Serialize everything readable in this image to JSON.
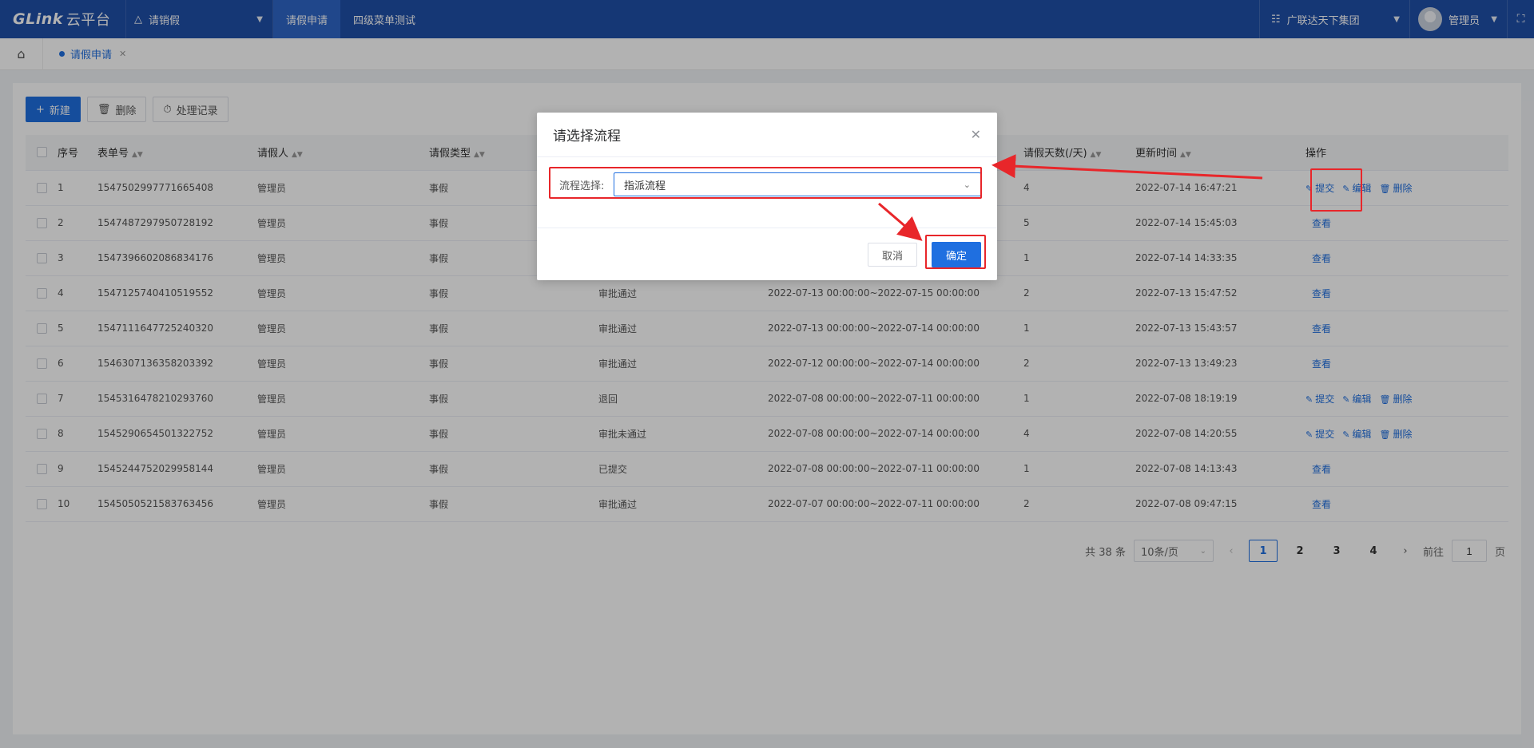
{
  "topbar": {
    "logo": "GLink",
    "logo_sub": "云平台",
    "app_name": "请销假",
    "menu": [
      "请假申请",
      "四级菜单测试"
    ],
    "org_name": "广联达天下集团",
    "user_name": "管理员",
    "accent": "#1f4fa8"
  },
  "tabs": {
    "active": "请假申请"
  },
  "toolbar": {
    "new": "新建",
    "delete": "删除",
    "records": "处理记录"
  },
  "table": {
    "headers": [
      "序号",
      "表单号",
      "请假人",
      "请假类型",
      "",
      "",
      "请假天数(/天)",
      "更新时间",
      "操作"
    ],
    "rows": [
      {
        "no": "1",
        "form": "1547502997771665408",
        "person": "管理员",
        "type": "事假",
        "status": "",
        "range": "",
        "days": "4",
        "updated": "2022-07-14 16:47:21",
        "ops": [
          "提交",
          "编辑",
          "删除"
        ]
      },
      {
        "no": "2",
        "form": "1547487297950728192",
        "person": "管理员",
        "type": "事假",
        "status": "",
        "range": "",
        "days": "5",
        "updated": "2022-07-14 15:45:03",
        "ops": [
          "查看"
        ]
      },
      {
        "no": "3",
        "form": "1547396602086834176",
        "person": "管理员",
        "type": "事假",
        "status": "",
        "range": "",
        "days": "1",
        "updated": "2022-07-14 14:33:35",
        "ops": [
          "查看"
        ]
      },
      {
        "no": "4",
        "form": "1547125740410519552",
        "person": "管理员",
        "type": "事假",
        "status": "审批通过",
        "range": "2022-07-13 00:00:00~2022-07-15 00:00:00",
        "days": "2",
        "updated": "2022-07-13 15:47:52",
        "ops": [
          "查看"
        ]
      },
      {
        "no": "5",
        "form": "1547111647725240320",
        "person": "管理员",
        "type": "事假",
        "status": "审批通过",
        "range": "2022-07-13 00:00:00~2022-07-14 00:00:00",
        "days": "1",
        "updated": "2022-07-13 15:43:57",
        "ops": [
          "查看"
        ]
      },
      {
        "no": "6",
        "form": "1546307136358203392",
        "person": "管理员",
        "type": "事假",
        "status": "审批通过",
        "range": "2022-07-12 00:00:00~2022-07-14 00:00:00",
        "days": "2",
        "updated": "2022-07-13 13:49:23",
        "ops": [
          "查看"
        ]
      },
      {
        "no": "7",
        "form": "1545316478210293760",
        "person": "管理员",
        "type": "事假",
        "status": "退回",
        "range": "2022-07-08 00:00:00~2022-07-11 00:00:00",
        "days": "1",
        "updated": "2022-07-08 18:19:19",
        "ops": [
          "提交",
          "编辑",
          "删除"
        ]
      },
      {
        "no": "8",
        "form": "1545290654501322752",
        "person": "管理员",
        "type": "事假",
        "status": "审批未通过",
        "range": "2022-07-08 00:00:00~2022-07-14 00:00:00",
        "days": "4",
        "updated": "2022-07-08 14:20:55",
        "ops": [
          "提交",
          "编辑",
          "删除"
        ]
      },
      {
        "no": "9",
        "form": "1545244752029958144",
        "person": "管理员",
        "type": "事假",
        "status": "已提交",
        "range": "2022-07-08 00:00:00~2022-07-11 00:00:00",
        "days": "1",
        "updated": "2022-07-08 14:13:43",
        "ops": [
          "查看"
        ]
      },
      {
        "no": "10",
        "form": "1545050521583763456",
        "person": "管理员",
        "type": "事假",
        "status": "审批通过",
        "range": "2022-07-07 00:00:00~2022-07-11 00:00:00",
        "days": "2",
        "updated": "2022-07-08 09:47:15",
        "ops": [
          "查看"
        ]
      }
    ]
  },
  "pagination": {
    "total": "共 38 条",
    "page_size": "10条/页",
    "pages": [
      "1",
      "2",
      "3",
      "4"
    ],
    "current": "1",
    "goto_label": "前往",
    "goto_value": "1",
    "page_unit": "页"
  },
  "dialog": {
    "title": "请选择流程",
    "label": "流程选择:",
    "selected": "指派流程",
    "cancel": "取消",
    "ok": "确定"
  },
  "annotation_color": "#e8262a"
}
